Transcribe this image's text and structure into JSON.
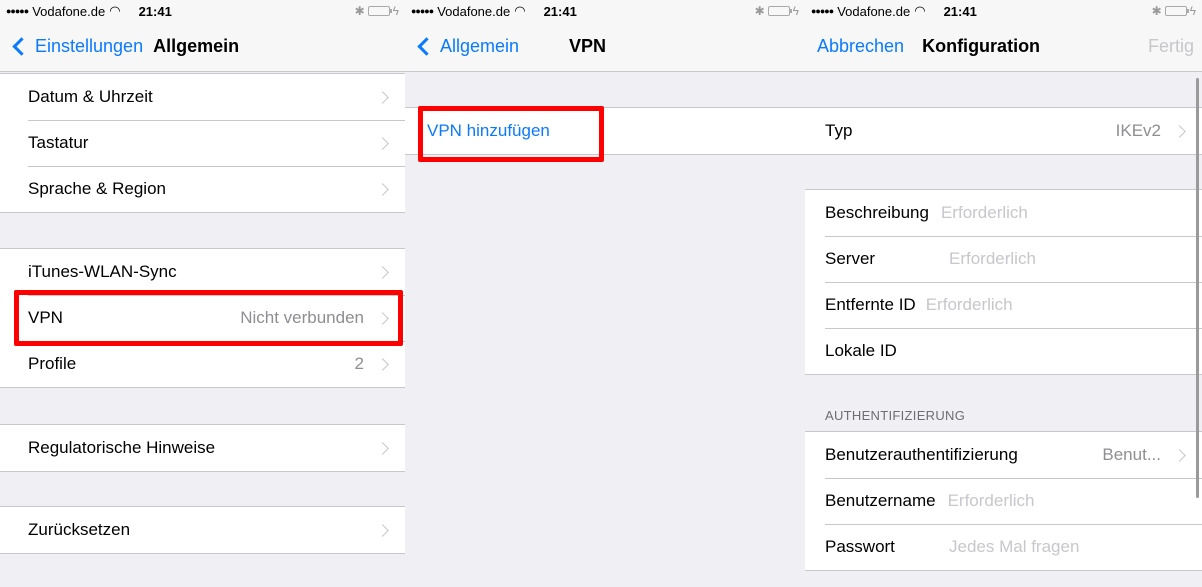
{
  "status": {
    "carrier": "Vodafone.de",
    "time": "21:41",
    "bluetooth": "✱"
  },
  "screen1": {
    "back_label": "Einstellungen",
    "title": "Allgemein",
    "group1": [
      "Datum & Uhrzeit",
      "Tastatur",
      "Sprache & Region"
    ],
    "group2": [
      {
        "label": "iTunes-WLAN-Sync",
        "value": ""
      },
      {
        "label": "VPN",
        "value": "Nicht verbunden"
      },
      {
        "label": "Profile",
        "value": "2"
      }
    ],
    "group3": [
      "Regulatorische Hinweise"
    ],
    "group4": [
      "Zurücksetzen"
    ]
  },
  "screen2": {
    "back_label": "Allgemein",
    "title": "VPN",
    "add_vpn": "VPN hinzufügen"
  },
  "screen3": {
    "cancel": "Abbrechen",
    "title": "Konfiguration",
    "done": "Fertig",
    "type_label": "Typ",
    "type_value": "IKEv2",
    "fields": [
      {
        "label": "Beschreibung",
        "placeholder": "Erforderlich"
      },
      {
        "label": "Server",
        "placeholder": "Erforderlich"
      },
      {
        "label": "Entfernte ID",
        "placeholder": "Erforderlich"
      },
      {
        "label": "Lokale ID",
        "placeholder": ""
      }
    ],
    "auth_header": "AUTHENTIFIZIERUNG",
    "user_auth_label": "Benutzerauthentifizierung",
    "user_auth_value": "Benut...",
    "auth_fields": [
      {
        "label": "Benutzername",
        "placeholder": "Erforderlich"
      },
      {
        "label": "Passwort",
        "placeholder": "Jedes Mal fragen"
      }
    ]
  },
  "colors": {
    "accent": "#0a7aff",
    "highlight": "#ff0000",
    "background": "#efeff4"
  }
}
